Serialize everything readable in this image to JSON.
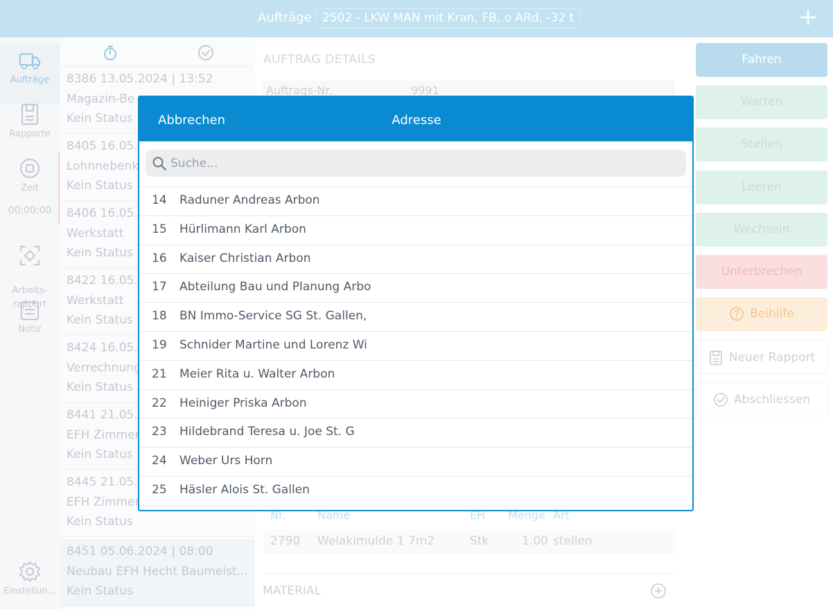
{
  "topbar": {
    "title": "Aufträge",
    "vehicle": "2502 - LKW MAN mit Kran, FB, o ARd, -32 t"
  },
  "nav": {
    "items": [
      {
        "label": "Aufträge"
      },
      {
        "label": "Rapporte"
      },
      {
        "label": "Zeit"
      },
      {
        "label": "Arbeits-\nrapport"
      },
      {
        "label": "Notiz"
      }
    ],
    "timer": "00:00:00",
    "settings": "Einstellun..."
  },
  "orders": [
    {
      "head": "8386  13.05.2024 | 13:52",
      "title": "Magazin-Be",
      "status": "Kein Status"
    },
    {
      "head": "8405  16.05.",
      "title": "Lohnnebenk",
      "status": "Kein Status"
    },
    {
      "head": "8406  16.05.",
      "title": "Werkstatt",
      "status": "Kein Status"
    },
    {
      "head": "8422  16.05.",
      "title": "Werkstatt",
      "status": "Kein Status"
    },
    {
      "head": "8424  16.05.",
      "title": "Verrechnung",
      "status": "Kein Status"
    },
    {
      "head": "8441  21.05.2",
      "title": "EFH Zimmer",
      "status": "Kein Status"
    },
    {
      "head": "8445  21.05.",
      "title": "EFH Zimmer",
      "status": "Kein Status"
    },
    {
      "head": "8451  05.06.2024 | 08:00",
      "title": "Neubau EFH Hecht Baumeist...",
      "status": "Kein Status"
    }
  ],
  "details": {
    "title": "AUFTRAG DETAILS",
    "order_no_label": "Auftrags-Nr.",
    "order_no_value": "9991",
    "articles_header": {
      "nr": "Nr.",
      "name": "Name",
      "eh": "EH",
      "menge": "Menge",
      "art": "Art"
    },
    "articles": [
      {
        "nr": "2790",
        "name": "Welakimulde 1 7m2",
        "eh": "Stk",
        "menge": "1.00",
        "art": "stellen"
      }
    ],
    "material_label": "MATERIAL"
  },
  "actions": [
    {
      "label": "Fahren"
    },
    {
      "label": "Warten"
    },
    {
      "label": "Stellen"
    },
    {
      "label": "Leeren"
    },
    {
      "label": "Wechseln"
    },
    {
      "label": "Unterbrechen"
    },
    {
      "label": "Beihilfe"
    },
    {
      "label": "Neuer Rapport"
    },
    {
      "label": "Abschliessen"
    }
  ],
  "modal": {
    "cancel": "Abbrechen",
    "title": "Adresse",
    "search_placeholder": "Suche...",
    "addresses": [
      {
        "num": "14",
        "name": "Raduner Andreas Arbon"
      },
      {
        "num": "15",
        "name": "Hürlimann Karl Arbon"
      },
      {
        "num": "16",
        "name": "Kaiser Christian Arbon"
      },
      {
        "num": "17",
        "name": "Abteilung Bau und Planung Arbo"
      },
      {
        "num": "18",
        "name": "BN Immo-Service SG St. Gallen,"
      },
      {
        "num": "19",
        "name": "Schnider Martine und Lorenz Wi"
      },
      {
        "num": "21",
        "name": "Meier Rita u. Walter Arbon"
      },
      {
        "num": "22",
        "name": "Heiniger Priska Arbon"
      },
      {
        "num": "23",
        "name": "Hildebrand Teresa u. Joe St. G"
      },
      {
        "num": "24",
        "name": "Weber Urs Horn"
      },
      {
        "num": "25",
        "name": "Häsler Alois St. Gallen"
      }
    ]
  }
}
